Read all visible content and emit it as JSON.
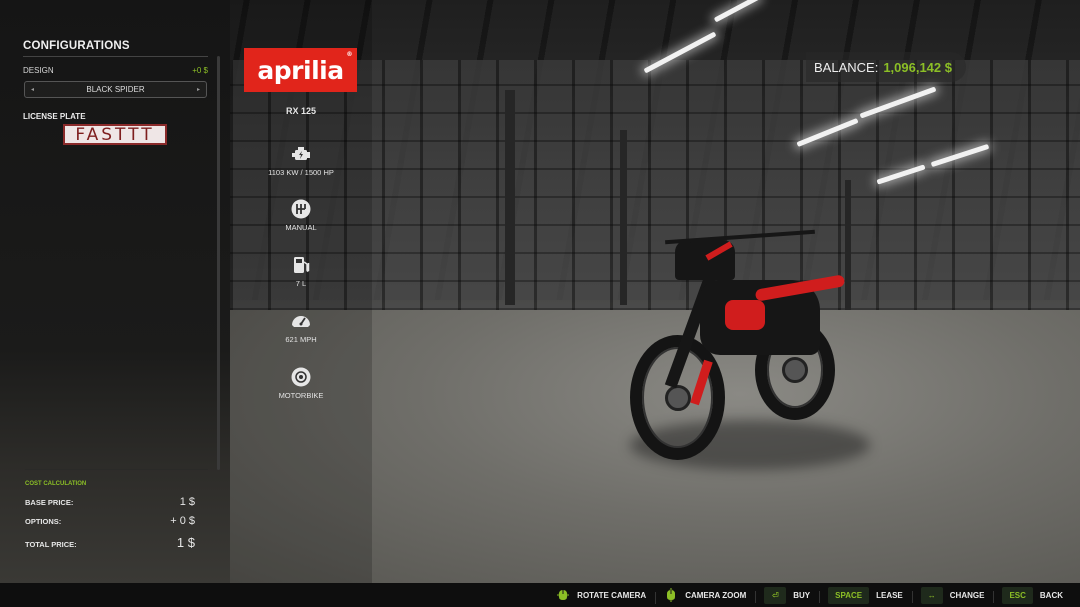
{
  "config_panel": {
    "title": "CONFIGURATIONS",
    "design": {
      "label": "DESIGN",
      "price": "+0 $",
      "value": "BLACK SPIDER",
      "prev_icon": "◂",
      "next_icon": "▸"
    },
    "license_plate": {
      "label": "LICENSE PLATE",
      "value": "FASTTT"
    },
    "cost": {
      "title": "COST CALCULATION",
      "rows": [
        {
          "label": "BASE PRICE:",
          "value": "1 $"
        },
        {
          "label": "OPTIONS:",
          "value": "+ 0 $"
        },
        {
          "label": "TOTAL PRICE:",
          "value": "1 $"
        }
      ]
    }
  },
  "vehicle": {
    "brand": "aprilia",
    "brand_mark": "®",
    "model": "RX 125",
    "specs": [
      {
        "icon": "engine-icon",
        "text": "1103 KW / 1500 HP"
      },
      {
        "icon": "gearshift-icon",
        "text": "MANUAL"
      },
      {
        "icon": "fuel-pump-icon",
        "text": "7 L"
      },
      {
        "icon": "speedometer-icon",
        "text": "621 MPH"
      },
      {
        "icon": "wheel-icon",
        "text": "MOTORBIKE"
      }
    ]
  },
  "balance": {
    "label": "BALANCE:",
    "value": "1,096,142 $"
  },
  "hints": [
    {
      "key": "",
      "glyph": "mouse-icon",
      "label": "ROTATE CAMERA"
    },
    {
      "key": "",
      "glyph": "mouse-icon",
      "label": "CAMERA ZOOM"
    },
    {
      "key": "⏎",
      "glyph": "enter-icon",
      "label": "BUY"
    },
    {
      "key": "SPACE",
      "glyph": "",
      "label": "LEASE"
    },
    {
      "key": "↔",
      "glyph": "arrows-icon",
      "label": "CHANGE"
    },
    {
      "key": "ESC",
      "glyph": "",
      "label": "BACK"
    }
  ],
  "colors": {
    "accent": "#8cbf26",
    "brand": "#e1251b",
    "plate_text": "#7e1e1e"
  }
}
